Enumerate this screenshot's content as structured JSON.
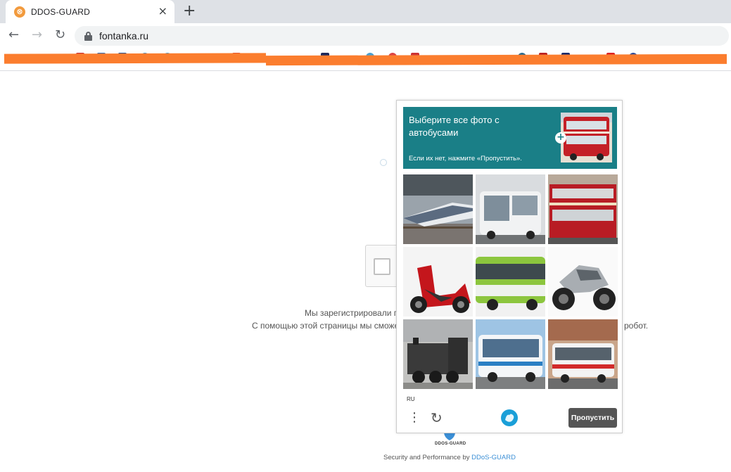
{
  "browser": {
    "tab_title": "DDOS-GUARD",
    "tab_close": "×",
    "new_tab": "+",
    "back": "←",
    "forward": "→",
    "reload": "↻",
    "url": "fontanka.ru",
    "accent_color": "#fb7d2e"
  },
  "page": {
    "message_line1": "Мы зарегистрировали п",
    "message_line2_left": "С помощью этой страницы мы сможе",
    "message_line2_right": "робот.",
    "logo_text": "DDOS-GUARD",
    "footer_prefix": "Security and Performance by ",
    "footer_link": "DDoS-GUARD"
  },
  "captcha": {
    "title": "Выберите все фото с автобусами",
    "subtitle": "Если их нет, нажмите «Пропустить».",
    "plus": "+",
    "header_color": "#1a7f87",
    "tiles": [
      {
        "subject": "high-speed train"
      },
      {
        "subject": "white city bus"
      },
      {
        "subject": "red double-decker bus"
      },
      {
        "subject": "red scooter"
      },
      {
        "subject": "green city bus"
      },
      {
        "subject": "silver motorcycle"
      },
      {
        "subject": "steam locomotive"
      },
      {
        "subject": "white blue coach bus"
      },
      {
        "subject": "white red city bus"
      }
    ],
    "language": "RU",
    "more_icon": "⋮",
    "reload_icon": "↻",
    "skip_label": "Пропустить"
  }
}
